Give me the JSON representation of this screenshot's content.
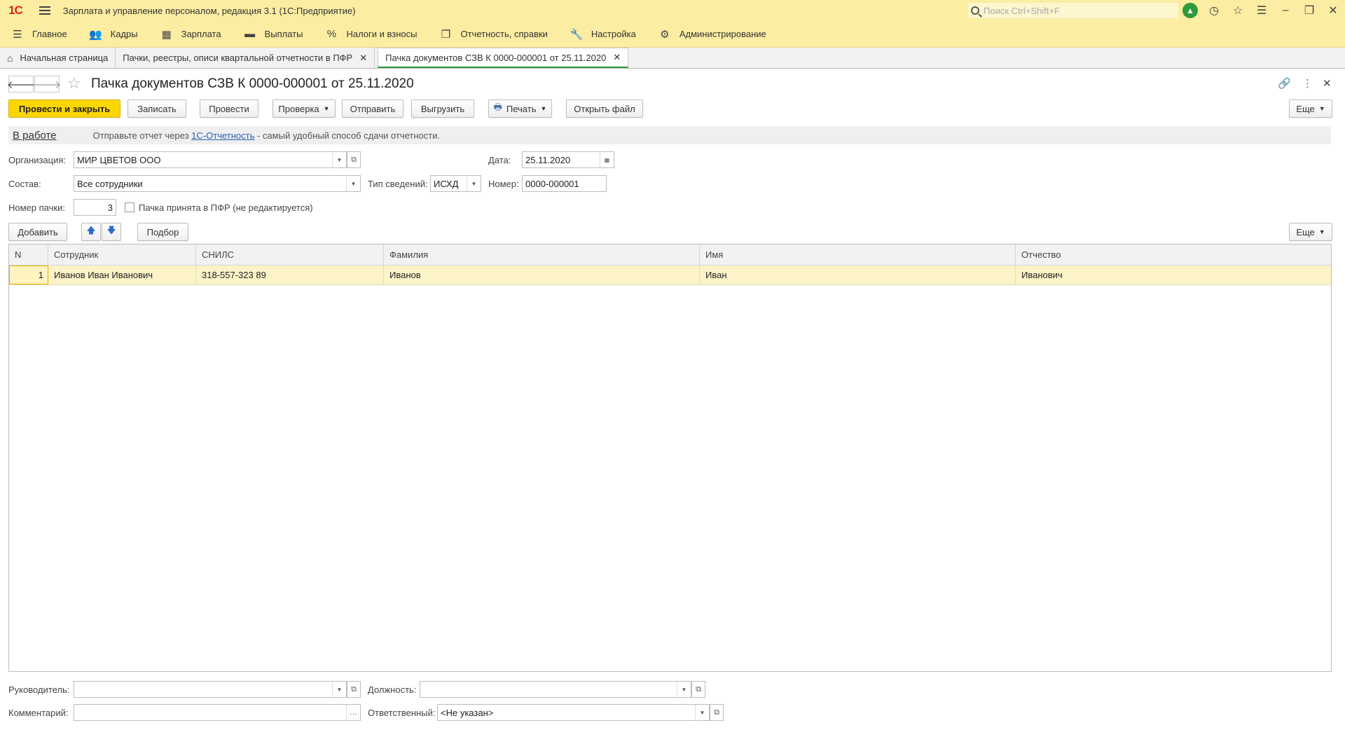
{
  "titlebar": {
    "logo": "1С",
    "title": "Зарплата и управление персоналом, редакция 3.1  (1С:Предприятие)",
    "search_placeholder": "Поиск Ctrl+Shift+F"
  },
  "menu": [
    {
      "label": "Главное",
      "icon": "menu-icon"
    },
    {
      "label": "Кадры",
      "icon": "people-icon"
    },
    {
      "label": "Зарплата",
      "icon": "calculator-icon"
    },
    {
      "label": "Выплаты",
      "icon": "wallet-icon"
    },
    {
      "label": "Налоги и взносы",
      "icon": "percent-icon"
    },
    {
      "label": "Отчетность, справки",
      "icon": "reports-icon"
    },
    {
      "label": "Настройка",
      "icon": "wrench-icon"
    },
    {
      "label": "Администрирование",
      "icon": "gear-icon"
    }
  ],
  "tabs": [
    {
      "label": "Начальная страница"
    },
    {
      "label": "Пачки, реестры, описи квартальной отчетности в ПФР"
    },
    {
      "label": "Пачка документов СЗВ К 0000-000001 от 25.11.2020"
    }
  ],
  "form": {
    "title": "Пачка документов СЗВ К 0000-000001 от 25.11.2020",
    "buttons": {
      "post_close": "Провести и закрыть",
      "save": "Записать",
      "post": "Провести",
      "check": "Проверка",
      "send": "Отправить",
      "export": "Выгрузить",
      "print": "Печать",
      "open_file": "Открыть файл",
      "more": "Еще"
    },
    "status": "В работе",
    "info_prefix": "Отправьте отчет через ",
    "info_link": "1С-Отчетность",
    "info_suffix": " - самый удобный способ сдачи отчетности.",
    "org_label": "Организация:",
    "org_value": "МИР ЦВЕТОВ ООО",
    "date_label": "Дата:",
    "date_value": "25.11.2020",
    "composition_label": "Состав:",
    "composition_value": "Все сотрудники",
    "type_label": "Тип сведений:",
    "type_value": "ИСХД",
    "number_label": "Номер:",
    "number_value": "0000-000001",
    "pack_number_label": "Номер пачки:",
    "pack_number_value": "3",
    "accepted_label": "Пачка принята в ПФР (не редактируется)",
    "accepted_checked": false
  },
  "table_toolbar": {
    "add": "Добавить",
    "pick": "Подбор",
    "more": "Еще"
  },
  "table": {
    "columns": [
      "N",
      "Сотрудник",
      "СНИЛС",
      "Фамилия",
      "Имя",
      "Отчество"
    ],
    "rows": [
      {
        "n": "1",
        "employee": "Иванов Иван Иванович",
        "snils": "318-557-323 89",
        "last": "Иванов",
        "first": "Иван",
        "middle": "Иванович"
      }
    ]
  },
  "footer": {
    "head_label": "Руководитель:",
    "head_value": "",
    "position_label": "Должность:",
    "position_value": "",
    "comment_label": "Комментарий:",
    "comment_value": "",
    "responsible_label": "Ответственный:",
    "responsible_value": "<Не указан>"
  }
}
